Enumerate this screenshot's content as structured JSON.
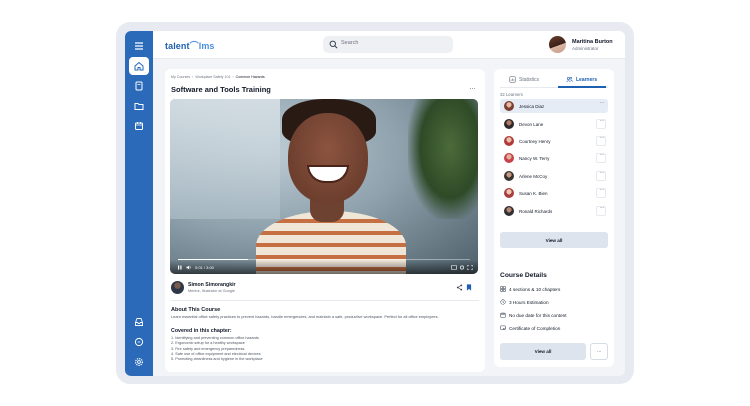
{
  "app": {
    "logo_main": "talent",
    "logo_lms": "lms"
  },
  "search": {
    "placeholder": "Search"
  },
  "user": {
    "name": "Maritina Burton",
    "role": "Administrator"
  },
  "sidebar": {
    "items": [
      {
        "icon": "menu-icon"
      },
      {
        "icon": "home-icon",
        "active": true
      },
      {
        "icon": "book-icon"
      },
      {
        "icon": "folder-icon"
      },
      {
        "icon": "calendar-icon"
      },
      {
        "icon": "inbox-icon"
      },
      {
        "icon": "chat-icon"
      },
      {
        "icon": "gear-icon"
      }
    ]
  },
  "course": {
    "breadcrumb": [
      "My Courses",
      "Workplace Safety 101",
      "Common Hazards"
    ],
    "title": "Software and Tools Training",
    "video": {
      "time": "0:01 / 3:00",
      "progress": 0.24
    },
    "instructor": {
      "name": "Simon Simorangkir",
      "role": "Mentor, Illustrator at Google"
    },
    "about_heading": "About This Course",
    "about_text": "Learn essential office safety practices to prevent hazards, handle emergencies, and maintain a safe, productive workspace. Perfect for all office employees.",
    "chapter_heading": "Covered in this chapter:",
    "chapter_items": [
      "1. Identifying and preventing common office hazards",
      "2. Ergonomic setup for a healthy workspace",
      "3. Fire safety and emergency preparedness",
      "4. Safe use of office equipment and electrical devices",
      "5. Promoting cleanliness and hygiene in the workplace"
    ]
  },
  "learners_panel": {
    "tabs": [
      {
        "label": "Statistics",
        "active": false
      },
      {
        "label": "Learners",
        "active": true
      }
    ],
    "count_label": "32 Learners",
    "learners": [
      {
        "name": "Jessica Diaz",
        "selected": true
      },
      {
        "name": "Devon Lane",
        "selected": false
      },
      {
        "name": "Courtney Henry",
        "selected": false
      },
      {
        "name": "Nancy W. Terry",
        "selected": false
      },
      {
        "name": "Arlene McCoy",
        "selected": false
      },
      {
        "name": "Susan K. Bien",
        "selected": false
      },
      {
        "name": "Ronald Richards",
        "selected": false
      }
    ],
    "view_all": "View all"
  },
  "course_details": {
    "heading": "Course Details",
    "rows": [
      {
        "icon": "grid-icon",
        "text": "4 sections & 10 chapters"
      },
      {
        "icon": "clock-icon",
        "text": "3 Hours Estimation"
      },
      {
        "icon": "calendar-icon",
        "text": "No due date for this content"
      },
      {
        "icon": "certificate-icon",
        "text": "Certificate of Completion"
      }
    ],
    "view_all": "View all"
  },
  "colors": {
    "brand": "#2a6ab8",
    "accent": "#1d5fb0",
    "selected_row": "#e5ecf5"
  }
}
